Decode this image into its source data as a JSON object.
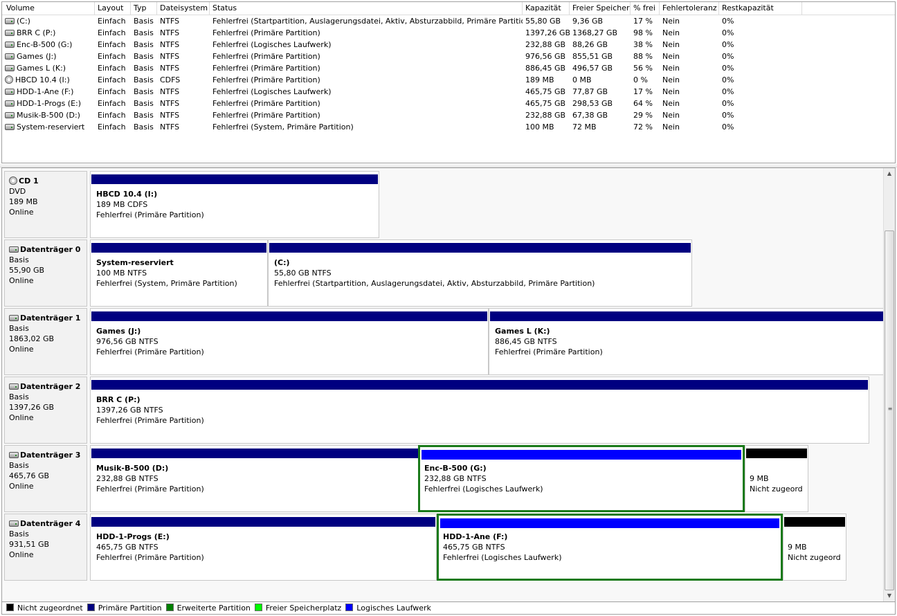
{
  "volume_list": {
    "columns": [
      "Volume",
      "Layout",
      "Typ",
      "Dateisystem",
      "Status",
      "Kapazität",
      "Freier Speicher",
      "% frei",
      "Fehlertoleranz",
      "Restkapazität"
    ],
    "rows": [
      {
        "icon": "drive-icon",
        "cells": [
          "(C:)",
          "Einfach",
          "Basis",
          "NTFS",
          "Fehlerfrei (Startpartition, Auslagerungsdatei, Aktiv, Absturzabbild, Primäre Partition)",
          "55,80 GB",
          "9,36 GB",
          "17 %",
          "Nein",
          "0%"
        ]
      },
      {
        "icon": "drive-icon",
        "cells": [
          "BRR C (P:)",
          "Einfach",
          "Basis",
          "NTFS",
          "Fehlerfrei (Primäre Partition)",
          "1397,26 GB",
          "1368,27 GB",
          "98 %",
          "Nein",
          "0%"
        ]
      },
      {
        "icon": "drive-icon",
        "cells": [
          "Enc-B-500 (G:)",
          "Einfach",
          "Basis",
          "NTFS",
          "Fehlerfrei (Logisches Laufwerk)",
          "232,88 GB",
          "88,26 GB",
          "38 %",
          "Nein",
          "0%"
        ]
      },
      {
        "icon": "drive-icon",
        "cells": [
          "Games (J:)",
          "Einfach",
          "Basis",
          "NTFS",
          "Fehlerfrei (Primäre Partition)",
          "976,56 GB",
          "855,51 GB",
          "88 %",
          "Nein",
          "0%"
        ]
      },
      {
        "icon": "drive-icon",
        "cells": [
          "Games L (K:)",
          "Einfach",
          "Basis",
          "NTFS",
          "Fehlerfrei (Primäre Partition)",
          "886,45 GB",
          "496,57 GB",
          "56 %",
          "Nein",
          "0%"
        ]
      },
      {
        "icon": "cd-drive-icon",
        "cells": [
          "HBCD 10.4 (I:)",
          "Einfach",
          "Basis",
          "CDFS",
          "Fehlerfrei (Primäre Partition)",
          "189 MB",
          "0 MB",
          "0 %",
          "Nein",
          "0%"
        ]
      },
      {
        "icon": "drive-icon",
        "cells": [
          "HDD-1-Ane (F:)",
          "Einfach",
          "Basis",
          "NTFS",
          "Fehlerfrei (Logisches Laufwerk)",
          "465,75 GB",
          "77,87 GB",
          "17 %",
          "Nein",
          "0%"
        ]
      },
      {
        "icon": "drive-icon",
        "cells": [
          "HDD-1-Progs (E:)",
          "Einfach",
          "Basis",
          "NTFS",
          "Fehlerfrei (Primäre Partition)",
          "465,75 GB",
          "298,53 GB",
          "64 %",
          "Nein",
          "0%"
        ]
      },
      {
        "icon": "drive-icon",
        "cells": [
          "Musik-B-500 (D:)",
          "Einfach",
          "Basis",
          "NTFS",
          "Fehlerfrei (Primäre Partition)",
          "232,88 GB",
          "67,38 GB",
          "29 %",
          "Nein",
          "0%"
        ]
      },
      {
        "icon": "drive-icon",
        "cells": [
          "System-reserviert",
          "Einfach",
          "Basis",
          "NTFS",
          "Fehlerfrei (System, Primäre Partition)",
          "100 MB",
          "72 MB",
          "72 %",
          "Nein",
          "0%"
        ]
      }
    ]
  },
  "colors": {
    "primary": "#000080",
    "logical": "#0000ff",
    "unallocated": "#000000",
    "extended": "#008000",
    "free": "#00ff00",
    "selection": "#1a7a1a"
  },
  "disks": [
    {
      "name": "CD 1",
      "type": "DVD",
      "size": "189 MB",
      "status": "Online",
      "icon": "cd-drive-icon",
      "partitions": [
        {
          "name": "HBCD 10.4  (I:)",
          "size": "189 MB CDFS",
          "status": "Fehlerfrei (Primäre Partition)",
          "kind": "primary",
          "selected": false
        }
      ]
    },
    {
      "name": "Datenträger 0",
      "type": "Basis",
      "size": "55,90 GB",
      "status": "Online",
      "icon": "drive-icon",
      "partitions": [
        {
          "name": "System-reserviert",
          "size": "100 MB NTFS",
          "status": "Fehlerfrei (System, Primäre Partition)",
          "kind": "primary",
          "selected": false
        },
        {
          "name": "(C:)",
          "size": "55,80 GB NTFS",
          "status": "Fehlerfrei (Startpartition, Auslagerungsdatei, Aktiv, Absturzabbild, Primäre Partition)",
          "kind": "primary",
          "selected": false
        }
      ]
    },
    {
      "name": "Datenträger 1",
      "type": "Basis",
      "size": "1863,02 GB",
      "status": "Online",
      "icon": "drive-icon",
      "partitions": [
        {
          "name": "Games  (J:)",
          "size": "976,56 GB NTFS",
          "status": "Fehlerfrei (Primäre Partition)",
          "kind": "primary",
          "selected": false
        },
        {
          "name": "Games L  (K:)",
          "size": "886,45 GB NTFS",
          "status": "Fehlerfrei (Primäre Partition)",
          "kind": "primary",
          "selected": false
        }
      ]
    },
    {
      "name": "Datenträger 2",
      "type": "Basis",
      "size": "1397,26 GB",
      "status": "Online",
      "icon": "drive-icon",
      "partitions": [
        {
          "name": "BRR C  (P:)",
          "size": "1397,26 GB NTFS",
          "status": "Fehlerfrei (Primäre Partition)",
          "kind": "primary",
          "selected": false
        }
      ]
    },
    {
      "name": "Datenträger 3",
      "type": "Basis",
      "size": "465,76 GB",
      "status": "Online",
      "icon": "drive-icon",
      "partitions": [
        {
          "name": "Musik-B-500  (D:)",
          "size": "232,88 GB NTFS",
          "status": "Fehlerfrei (Primäre Partition)",
          "kind": "primary",
          "selected": false
        },
        {
          "name": "Enc-B-500  (G:)",
          "size": "232,88 GB NTFS",
          "status": "Fehlerfrei (Logisches Laufwerk)",
          "kind": "logical",
          "selected": true
        },
        {
          "name": "",
          "size": "9 MB",
          "status": "Nicht zugeord",
          "kind": "unallocated",
          "selected": false
        }
      ]
    },
    {
      "name": "Datenträger 4",
      "type": "Basis",
      "size": "931,51 GB",
      "status": "Online",
      "icon": "drive-icon",
      "partitions": [
        {
          "name": "HDD-1-Progs  (E:)",
          "size": "465,75 GB NTFS",
          "status": "Fehlerfrei (Primäre Partition)",
          "kind": "primary",
          "selected": false
        },
        {
          "name": "HDD-1-Ane  (F:)",
          "size": "465,75 GB NTFS",
          "status": "Fehlerfrei (Logisches Laufwerk)",
          "kind": "logical",
          "selected": true
        },
        {
          "name": "",
          "size": "9 MB",
          "status": "Nicht zugeord",
          "kind": "unallocated",
          "selected": false
        }
      ]
    }
  ],
  "legend": [
    {
      "label": "Nicht zugeordnet",
      "color": "#000000"
    },
    {
      "label": "Primäre Partition",
      "color": "#000080"
    },
    {
      "label": "Erweiterte Partition",
      "color": "#008000"
    },
    {
      "label": "Freier Speicherplatz",
      "color": "#00ff00"
    },
    {
      "label": "Logisches Laufwerk",
      "color": "#0000ff"
    }
  ],
  "scrollbar": {
    "up_icon": "scroll-up-arrow-icon",
    "down_icon": "scroll-down-arrow-icon",
    "grip": "≡"
  }
}
